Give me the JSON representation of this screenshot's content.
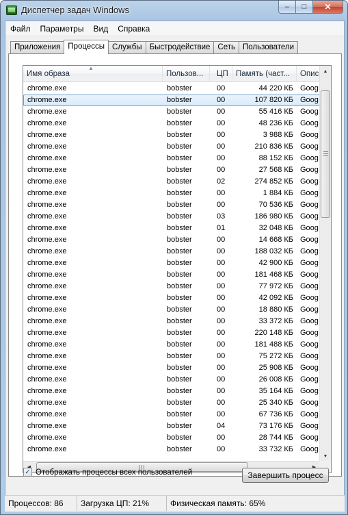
{
  "window": {
    "title": "Диспетчер задач Windows"
  },
  "caption_buttons": {
    "minimize": "‒",
    "maximize": "□",
    "close": "✕"
  },
  "menu": [
    "Файл",
    "Параметры",
    "Вид",
    "Справка"
  ],
  "tabs": [
    {
      "label": "Приложения",
      "active": false
    },
    {
      "label": "Процессы",
      "active": true
    },
    {
      "label": "Службы",
      "active": false
    },
    {
      "label": "Быстродействие",
      "active": false
    },
    {
      "label": "Сеть",
      "active": false
    },
    {
      "label": "Пользователи",
      "active": false
    }
  ],
  "columns": {
    "name": "Имя образа",
    "user": "Пользов...",
    "cpu": "ЦП",
    "memory": "Память (част...",
    "description": "Опис"
  },
  "rows": [
    {
      "name": "chrome.exe",
      "user": "bobster",
      "cpu": "00",
      "memory": "44 220 КБ",
      "desc": "Goog"
    },
    {
      "name": "chrome.exe",
      "user": "bobster",
      "cpu": "00",
      "memory": "107 820 КБ",
      "desc": "Goog",
      "selected": true
    },
    {
      "name": "chrome.exe",
      "user": "bobster",
      "cpu": "00",
      "memory": "55 416 КБ",
      "desc": "Goog"
    },
    {
      "name": "chrome.exe",
      "user": "bobster",
      "cpu": "00",
      "memory": "48 236 КБ",
      "desc": "Goog"
    },
    {
      "name": "chrome.exe",
      "user": "bobster",
      "cpu": "00",
      "memory": "3 988 КБ",
      "desc": "Goog"
    },
    {
      "name": "chrome.exe",
      "user": "bobster",
      "cpu": "00",
      "memory": "210 836 КБ",
      "desc": "Goog"
    },
    {
      "name": "chrome.exe",
      "user": "bobster",
      "cpu": "00",
      "memory": "88 152 КБ",
      "desc": "Goog"
    },
    {
      "name": "chrome.exe",
      "user": "bobster",
      "cpu": "00",
      "memory": "27 568 КБ",
      "desc": "Goog"
    },
    {
      "name": "chrome.exe",
      "user": "bobster",
      "cpu": "02",
      "memory": "274 852 КБ",
      "desc": "Goog"
    },
    {
      "name": "chrome.exe",
      "user": "bobster",
      "cpu": "00",
      "memory": "1 884 КБ",
      "desc": "Goog"
    },
    {
      "name": "chrome.exe",
      "user": "bobster",
      "cpu": "00",
      "memory": "70 536 КБ",
      "desc": "Goog"
    },
    {
      "name": "chrome.exe",
      "user": "bobster",
      "cpu": "03",
      "memory": "186 980 КБ",
      "desc": "Goog"
    },
    {
      "name": "chrome.exe",
      "user": "bobster",
      "cpu": "01",
      "memory": "32 048 КБ",
      "desc": "Goog"
    },
    {
      "name": "chrome.exe",
      "user": "bobster",
      "cpu": "00",
      "memory": "14 668 КБ",
      "desc": "Goog"
    },
    {
      "name": "chrome.exe",
      "user": "bobster",
      "cpu": "00",
      "memory": "188 032 КБ",
      "desc": "Goog"
    },
    {
      "name": "chrome.exe",
      "user": "bobster",
      "cpu": "00",
      "memory": "42 900 КБ",
      "desc": "Goog"
    },
    {
      "name": "chrome.exe",
      "user": "bobster",
      "cpu": "00",
      "memory": "181 468 КБ",
      "desc": "Goog"
    },
    {
      "name": "chrome.exe",
      "user": "bobster",
      "cpu": "00",
      "memory": "77 972 КБ",
      "desc": "Goog"
    },
    {
      "name": "chrome.exe",
      "user": "bobster",
      "cpu": "00",
      "memory": "42 092 КБ",
      "desc": "Goog"
    },
    {
      "name": "chrome.exe",
      "user": "bobster",
      "cpu": "00",
      "memory": "18 880 КБ",
      "desc": "Goog"
    },
    {
      "name": "chrome.exe",
      "user": "bobster",
      "cpu": "00",
      "memory": "33 372 КБ",
      "desc": "Goog"
    },
    {
      "name": "chrome.exe",
      "user": "bobster",
      "cpu": "00",
      "memory": "220 148 КБ",
      "desc": "Goog"
    },
    {
      "name": "chrome.exe",
      "user": "bobster",
      "cpu": "00",
      "memory": "181 488 КБ",
      "desc": "Goog"
    },
    {
      "name": "chrome.exe",
      "user": "bobster",
      "cpu": "00",
      "memory": "75 272 КБ",
      "desc": "Goog"
    },
    {
      "name": "chrome.exe",
      "user": "bobster",
      "cpu": "00",
      "memory": "25 908 КБ",
      "desc": "Goog"
    },
    {
      "name": "chrome.exe",
      "user": "bobster",
      "cpu": "00",
      "memory": "26 008 КБ",
      "desc": "Goog"
    },
    {
      "name": "chrome.exe",
      "user": "bobster",
      "cpu": "00",
      "memory": "35 164 КБ",
      "desc": "Goog"
    },
    {
      "name": "chrome.exe",
      "user": "bobster",
      "cpu": "00",
      "memory": "25 340 КБ",
      "desc": "Goog"
    },
    {
      "name": "chrome.exe",
      "user": "bobster",
      "cpu": "00",
      "memory": "67 736 КБ",
      "desc": "Goog"
    },
    {
      "name": "chrome.exe",
      "user": "bobster",
      "cpu": "04",
      "memory": "73 176 КБ",
      "desc": "Goog"
    },
    {
      "name": "chrome.exe",
      "user": "bobster",
      "cpu": "00",
      "memory": "28 744 КБ",
      "desc": "Goog"
    },
    {
      "name": "chrome.exe",
      "user": "bobster",
      "cpu": "00",
      "memory": "33 732 КБ",
      "desc": "Goog"
    }
  ],
  "show_all_processes": {
    "label": "Отображать процессы всех пользователей",
    "checked": true
  },
  "end_process_button": "Завершить процесс",
  "status": {
    "processes": "Процессов: 86",
    "cpu_load": "Загрузка ЦП: 21%",
    "physical_memory": "Физическая память: 65%"
  }
}
